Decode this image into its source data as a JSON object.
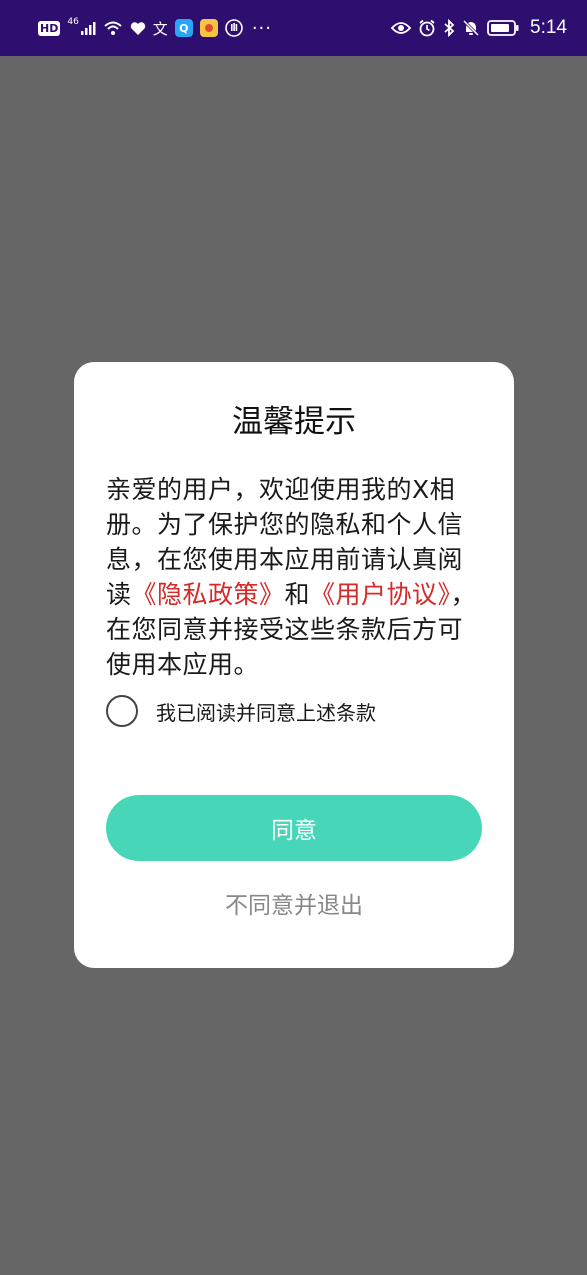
{
  "status_bar": {
    "hd_label": "HD",
    "network_label": "46",
    "app_glyph_1": "文",
    "app_glyph_2": "Q",
    "dots": "···",
    "time": "5:14"
  },
  "dialog": {
    "title": "温馨提示",
    "message_parts": {
      "part1": "亲爱的用户，欢迎使用我的X相册。为了保护您的隐私和个人信息，在您使用本应用前请认真阅读",
      "privacy_link": "《隐私政策》",
      "part2": "和",
      "terms_link": "《用户协议》",
      "part3": "，在您同意并接受这些条款后方可使用本应用。"
    },
    "checkbox_label": "我已阅读并同意上述条款",
    "agree_label": "同意",
    "disagree_label": "不同意并退出"
  },
  "colors": {
    "status_bar_bg": "#2e0e6e",
    "overlay_bg": "#666666",
    "accent": "#47d7b8",
    "link": "#d42a2a"
  }
}
